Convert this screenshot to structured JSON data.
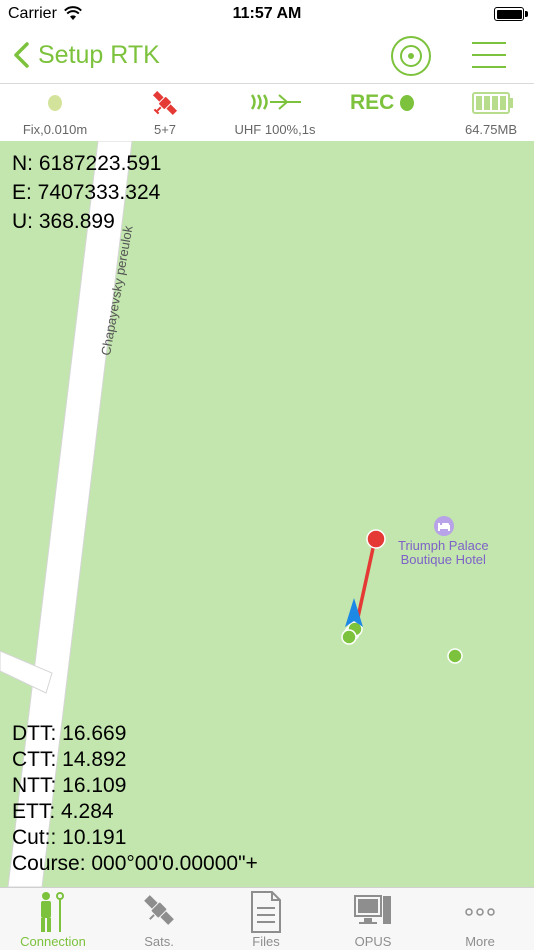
{
  "status_bar": {
    "carrier": "Carrier",
    "time": "11:57 AM"
  },
  "nav": {
    "back_label": "Setup RTK"
  },
  "info": {
    "fix": "Fix,0.010m",
    "sats": "5+7",
    "radio": "UHF 100%,1s",
    "rec": "REC",
    "storage": "64.75MB"
  },
  "map": {
    "coords": {
      "n": "N: 6187223.591",
      "e": "E: 7407333.324",
      "u": "U: 368.899"
    },
    "street": "Chapayevsky pereulok",
    "poi_line1": "Triumph Palace",
    "poi_line2": "Boutique Hotel"
  },
  "stats": {
    "dtt": "DTT: 16.669",
    "ctt": "CTT: 14.892",
    "ntt": "NTT: 16.109",
    "ett": "ETT: 4.284",
    "cut": "Cut:: 10.191",
    "course": "Course: 000°00'0.00000\"+"
  },
  "tabs": [
    {
      "label": "Connection",
      "active": true
    },
    {
      "label": "Sats.",
      "active": false
    },
    {
      "label": "Files",
      "active": false
    },
    {
      "label": "OPUS",
      "active": false
    },
    {
      "label": "More",
      "active": false
    }
  ],
  "colors": {
    "accent": "#7cc23c",
    "map_bg": "#c2e6ad",
    "target_red": "#e53935",
    "track": "#e53935",
    "poi": "#7e62c8"
  }
}
